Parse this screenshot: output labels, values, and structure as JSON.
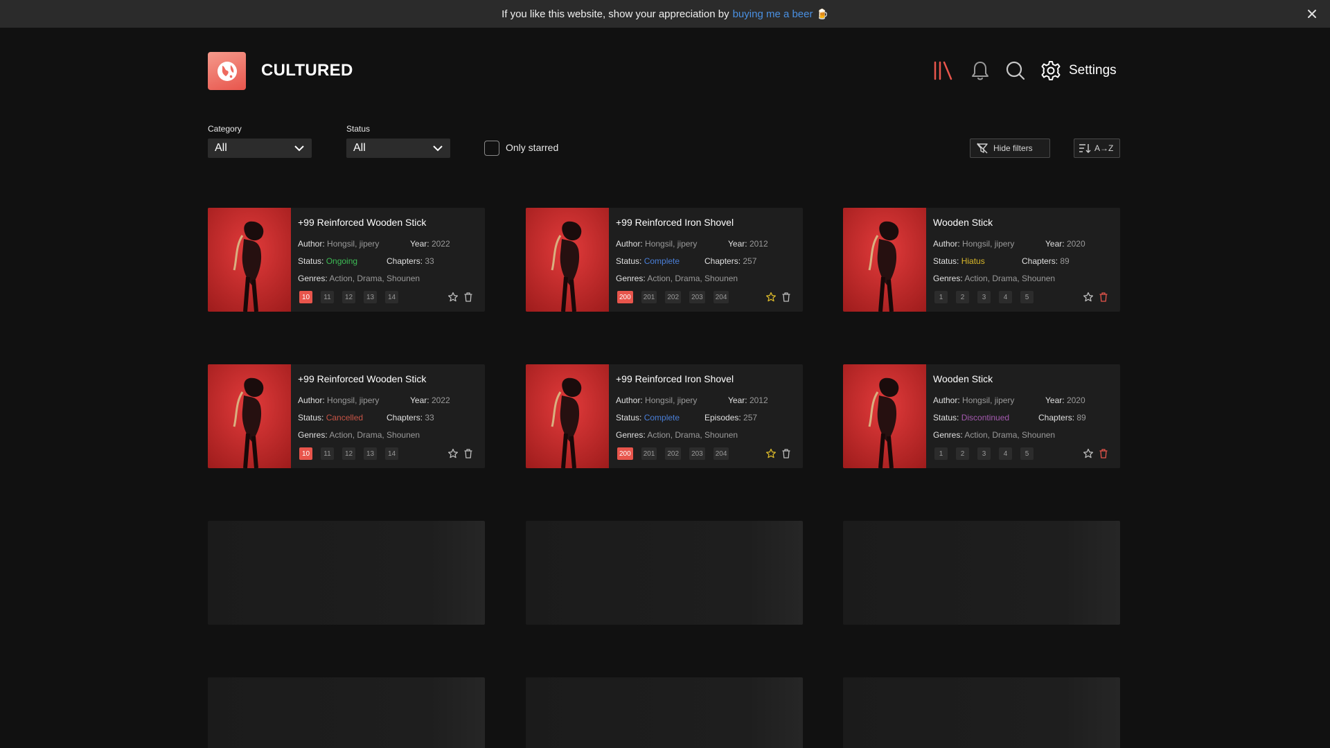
{
  "banner": {
    "text": "If you like this website, show your appreciation by",
    "link": "buying me a beer",
    "emoji": "🍺"
  },
  "header": {
    "brand": "CULTURED",
    "settings_label": "Settings"
  },
  "filters": {
    "category": {
      "label": "Category",
      "value": "All"
    },
    "status": {
      "label": "Status",
      "value": "All"
    },
    "only_starred": {
      "label": "Only starred",
      "checked": false
    },
    "hide_filters": "Hide filters",
    "sort": "A→Z"
  },
  "labels": {
    "author": "Author:",
    "year": "Year:",
    "status": "Status:",
    "genres": "Genres:"
  },
  "colors": {
    "accent": "#e8554c",
    "ongoing": "#3dbb55",
    "complete": "#4a7fd8",
    "hiatus": "#d9b82a",
    "cancelled": "#c75446",
    "discontinued": "#a55ab0"
  },
  "cards": [
    {
      "title": "+99 Reinforced Wooden Stick",
      "author": "Hongsil, jipery",
      "year": "2022",
      "status": "Ongoing",
      "status_color": "#3dbb55",
      "count_label": "Chapters:",
      "count": "33",
      "genres": "Action, Drama, Shounen",
      "chapters": [
        "10",
        "11",
        "12",
        "13",
        "14"
      ],
      "active_chapter": 0,
      "starred": false,
      "delete_icon": "trash-icon"
    },
    {
      "title": "+99 Reinforced Iron Shovel",
      "author": "Hongsil, jipery",
      "year": "2012",
      "status": "Complete",
      "status_color": "#4a7fd8",
      "count_label": "Chapters:",
      "count": "257",
      "genres": "Action, Drama, Shounen",
      "chapters": [
        "200",
        "201",
        "202",
        "203",
        "204"
      ],
      "active_chapter": 0,
      "starred": true,
      "delete_icon": "trash-icon"
    },
    {
      "title": "Wooden Stick",
      "author": "Hongsil, jipery",
      "year": "2020",
      "status": "Hiatus",
      "status_color": "#d9b82a",
      "count_label": "Chapters:",
      "count": "89",
      "genres": "Action, Drama, Shounen",
      "chapters": [
        "1",
        "2",
        "3",
        "4",
        "5"
      ],
      "active_chapter": -1,
      "starred": false,
      "delete_icon": "trash-icon"
    },
    {
      "title": "+99 Reinforced Wooden Stick",
      "author": "Hongsil, jipery",
      "year": "2022",
      "status": "Cancelled",
      "status_color": "#c75446",
      "count_label": "Chapters:",
      "count": "33",
      "genres": "Action, Drama, Shounen",
      "chapters": [
        "10",
        "11",
        "12",
        "13",
        "14"
      ],
      "active_chapter": 0,
      "starred": false,
      "delete_icon": "trash-icon"
    },
    {
      "title": "+99 Reinforced Iron Shovel",
      "author": "Hongsil, jipery",
      "year": "2012",
      "status": "Complete",
      "status_color": "#4a7fd8",
      "count_label": "Episodes:",
      "count": "257",
      "genres": "Action, Drama, Shounen",
      "chapters": [
        "200",
        "201",
        "202",
        "203",
        "204"
      ],
      "active_chapter": 0,
      "starred": true,
      "delete_icon": "trash-icon"
    },
    {
      "title": "Wooden Stick",
      "author": "Hongsil, jipery",
      "year": "2020",
      "status": "Discontinued",
      "status_color": "#a55ab0",
      "count_label": "Chapters:",
      "count": "89",
      "genres": "Action, Drama, Shounen",
      "chapters": [
        "1",
        "2",
        "3",
        "4",
        "5"
      ],
      "active_chapter": -1,
      "starred": false,
      "delete_icon": "trash-icon"
    }
  ]
}
